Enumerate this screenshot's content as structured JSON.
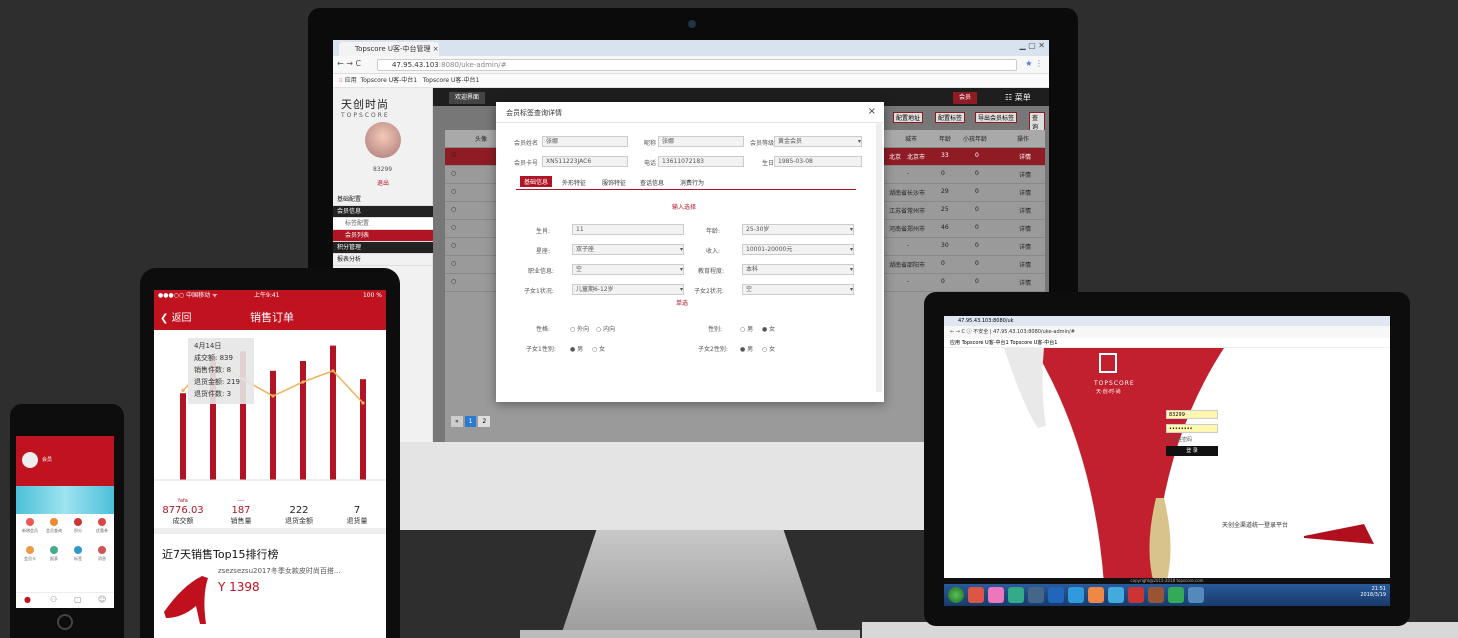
{
  "monitor": {
    "tab_title": "Topscore U客-中台管理",
    "url_host": "47.95.43.103",
    "url_rest": ":8080/uke-admin/#",
    "bookmarks": [
      "应用",
      "Topscore U客-中台1",
      "Topscore U客-中台1"
    ],
    "brand_cn": "天创时尚",
    "brand_en": "TOPSCORE",
    "user_id": "83299",
    "logout": "退出",
    "menu": [
      "基础配置",
      "会员信息",
      "标签配置",
      "会员列表",
      "积分管理",
      "报表分析"
    ],
    "topnav": [
      "欢迎界面",
      "会员",
      "菜单"
    ],
    "toolbar": [
      "配置地址",
      "配置标签",
      "导出会员标签",
      "查询"
    ],
    "columns": [
      "头像",
      "城市",
      "年龄",
      "小孩年龄",
      "操作"
    ],
    "rows": [
      {
        "province": "北京",
        "city": "北京市",
        "age": "33",
        "kid": "0",
        "op": "详情"
      },
      {
        "province": "",
        "city": "-",
        "age": "0",
        "kid": "0",
        "op": "详情"
      },
      {
        "province": "湖南省",
        "city": "长沙市",
        "age": "29",
        "kid": "0",
        "op": "详情"
      },
      {
        "province": "江苏省",
        "city": "常州市",
        "age": "25",
        "kid": "0",
        "op": "详情"
      },
      {
        "province": "河南省",
        "city": "郑州市",
        "age": "46",
        "kid": "0",
        "op": "详情"
      },
      {
        "province": "",
        "city": "-",
        "age": "30",
        "kid": "0",
        "op": "详情"
      },
      {
        "province": "湖南省",
        "city": "邵阳市",
        "age": "0",
        "kid": "0",
        "op": "详情"
      },
      {
        "province": "",
        "city": "-",
        "age": "0",
        "kid": "0",
        "op": "详情"
      }
    ],
    "pagination": [
      "1",
      "2"
    ],
    "dialog": {
      "title": "会员标签查询详情",
      "close": "×",
      "name_label": "会员姓名",
      "name_value": "张娜",
      "nick_label": "昵称",
      "nick_value": "张娜",
      "level_label": "会员等级",
      "level_value": "黄金会员",
      "card_label": "会员卡号",
      "card_value": "XN511223JAC6",
      "phone_label": "电话",
      "phone_value": "13611072183",
      "birth_label": "生日",
      "birth_value": "1985-03-08",
      "tabs": [
        "基础信息",
        "外形特征",
        "服饰特征",
        "查话信息",
        "消费行为"
      ],
      "section1": "输入选择",
      "f_shengxiao": "生肖:",
      "v_shengxiao": "11",
      "f_age": "年龄:",
      "v_age": "25-30岁",
      "f_xingzuo": "星座:",
      "v_xingzuo": "双子座",
      "f_income": "收入:",
      "v_income": "10001-20000元",
      "f_job": "职业信息:",
      "v_job": "空",
      "f_edu": "教育程度:",
      "v_edu": "本科",
      "f_kid1": "子女1状况:",
      "v_kid1": "儿童期6-12岁",
      "f_kid2": "子女2状况:",
      "v_kid2": "空",
      "section2": "单选",
      "f_character": "性格:",
      "o_character": [
        "外向",
        "内向"
      ],
      "f_gender": "性别:",
      "o_gender": [
        "男",
        "女"
      ],
      "f_kid1g": "子女1性别:",
      "o_kid1g": [
        "男",
        "女"
      ],
      "f_kid2g": "子女2性别:",
      "o_kid2g": [
        "男",
        "女"
      ]
    }
  },
  "phone_large": {
    "carrier": "●●●○○ 中国移动 ᯤ",
    "time": "上午9:41",
    "battery": "100 %",
    "back": "返回",
    "title": "销售订单",
    "tooltip": {
      "date": "4月14日",
      "lines": [
        "成交额: 839",
        "销售件数: 8",
        "退货金额: 219",
        "退货件数: 3"
      ]
    },
    "summary": [
      {
        "value": "8776.03",
        "label": "成交额",
        "tag": "fafa"
      },
      {
        "value": "187",
        "label": "销售量",
        "tag": "----"
      },
      {
        "value": "222",
        "label": "退货金额",
        "tag": ""
      },
      {
        "value": "7",
        "label": "退货量",
        "tag": ""
      }
    ],
    "rank_title": "近7天销售Top15排行榜",
    "product_name": "zsezsezsu2017冬季女款皮时尚百搭...",
    "product_price": "Y 1398"
  },
  "chart_data": {
    "type": "bar",
    "bars": [
      62,
      88,
      92,
      78,
      85,
      96,
      72
    ],
    "line": [
      64,
      86,
      72,
      60,
      70,
      78,
      55
    ],
    "ylim": [
      0,
      100
    ]
  },
  "tablet": {
    "tab_title": "47.95.43.103:8080/uk",
    "url_prefix": "不安全",
    "url": "47.95.43.103:8080/uke-admin/#",
    "bookmarks": "应用  Topscore U客-中台1  Topscore U客-中台1",
    "brand": "TOPSCORE",
    "brand_sub": "天·创·时·尚",
    "username": "83299",
    "password": "••••••••",
    "remember": "记住密码",
    "login": "登 录",
    "slogan": "天创全渠道统一登录平台",
    "footer": "copyright@2015-2018 topscore.com",
    "clock_time": "21:51",
    "clock_date": "2018/3/19"
  },
  "phone_small": {
    "user": "会员",
    "menu": [
      "新增会员",
      "会员查询",
      "积分",
      "优惠券",
      "会员卡",
      "报表",
      "标签",
      "消息"
    ]
  }
}
